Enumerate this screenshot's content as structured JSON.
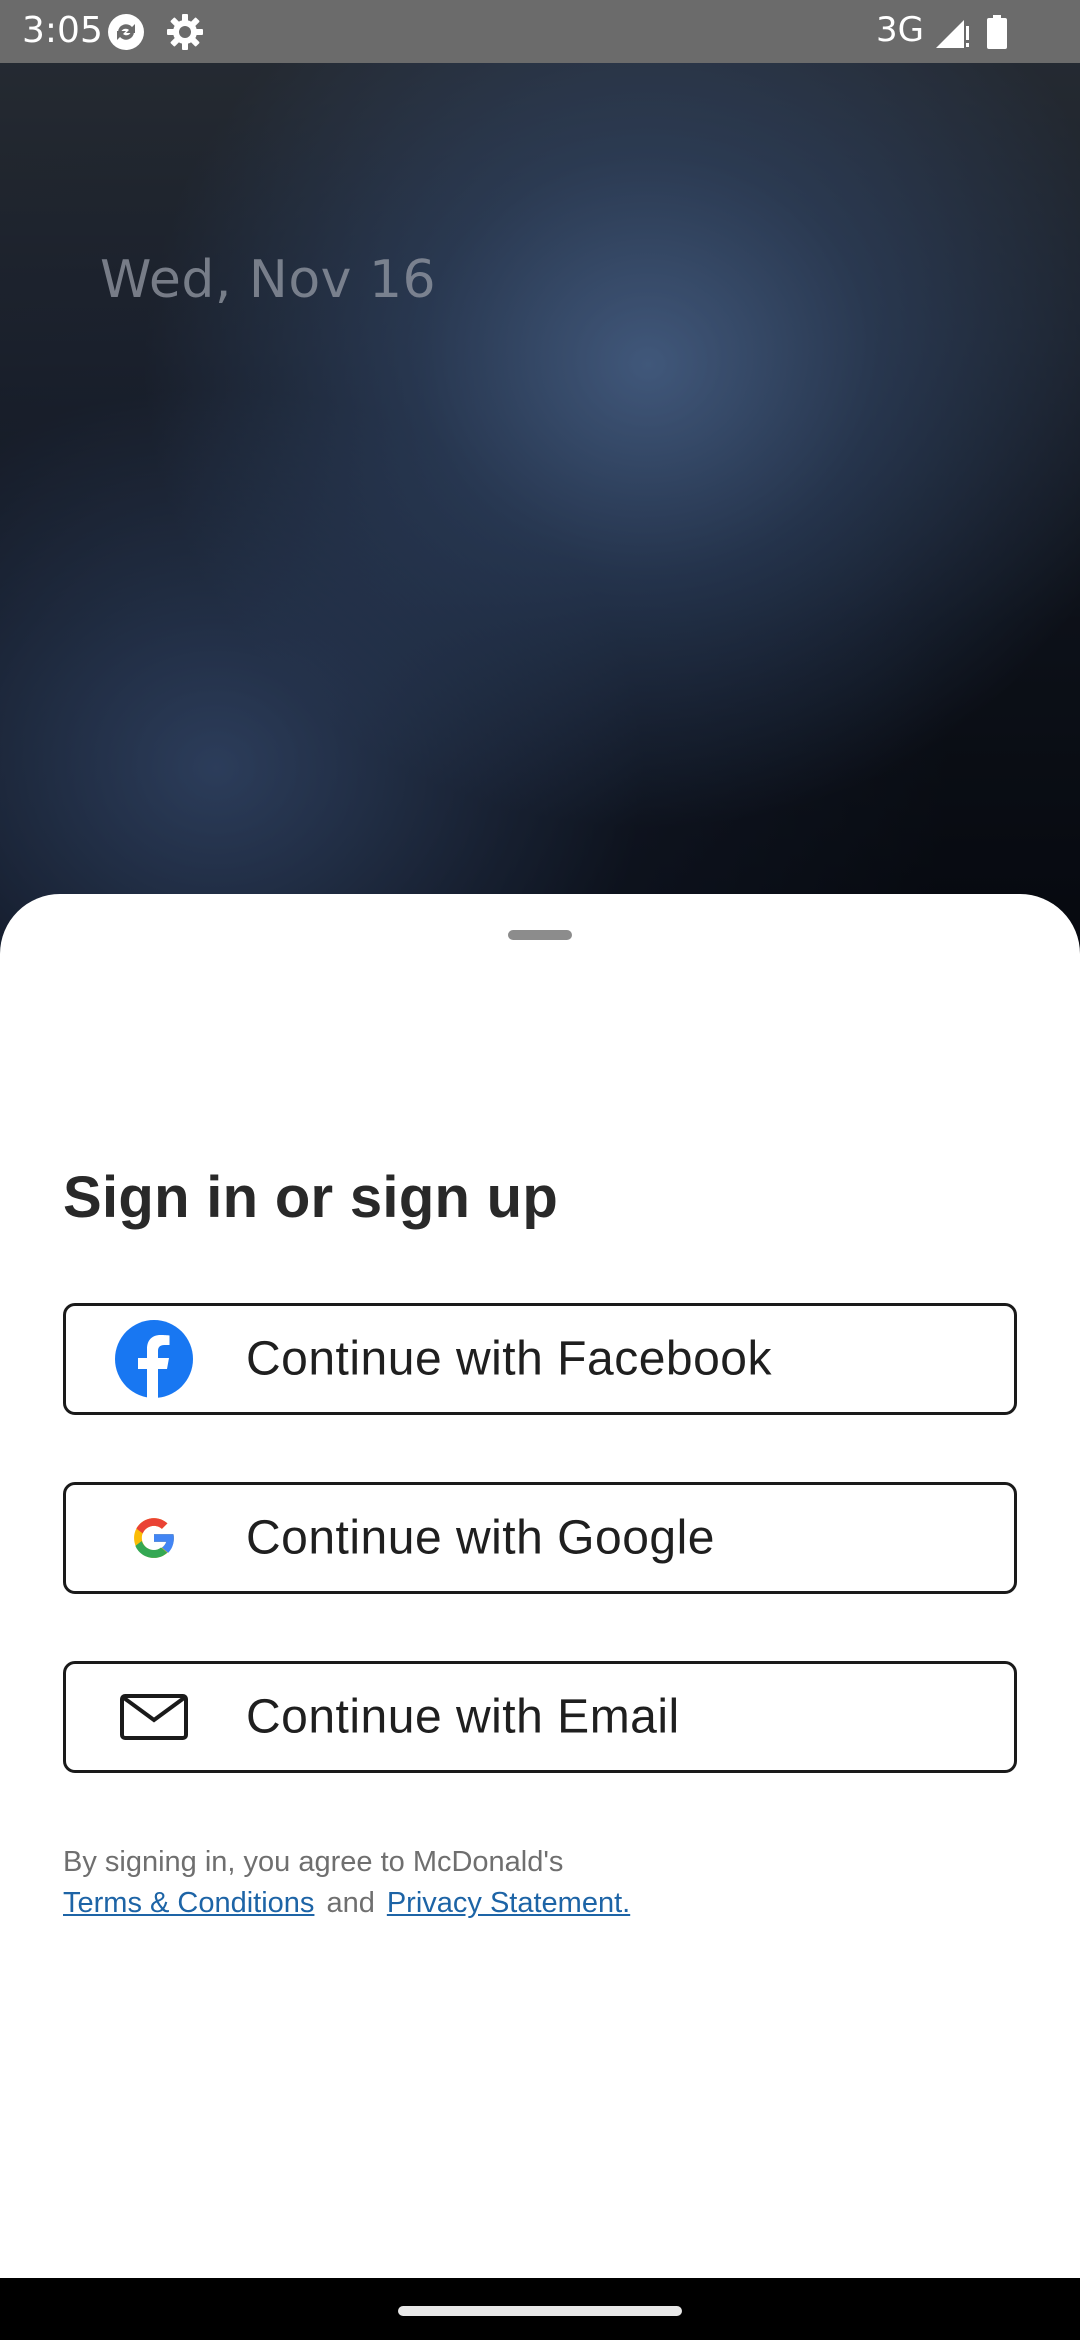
{
  "status_bar": {
    "time": "3:05",
    "network": "3G",
    "icons": [
      "sync-icon",
      "gear-icon",
      "signal-icon",
      "battery-icon"
    ]
  },
  "lockscreen": {
    "date": "Wed, Nov 16"
  },
  "sheet": {
    "title": "Sign in or sign up",
    "buttons": [
      {
        "label": "Continue with Facebook",
        "icon": "facebook-icon"
      },
      {
        "label": "Continue with Google",
        "icon": "google-icon"
      },
      {
        "label": "Continue with Email",
        "icon": "email-icon"
      }
    ],
    "legal": {
      "prefix": "By signing in, you agree to McDonald's",
      "terms_link": "Terms & Conditions",
      "conjunction": "and",
      "privacy_link": "Privacy Statement."
    }
  },
  "colors": {
    "link": "#1d64a6",
    "facebook": "#1877f2",
    "google_blue": "#4285f4",
    "google_red": "#ea4335",
    "google_yellow": "#fbbc05",
    "google_green": "#34a853"
  }
}
